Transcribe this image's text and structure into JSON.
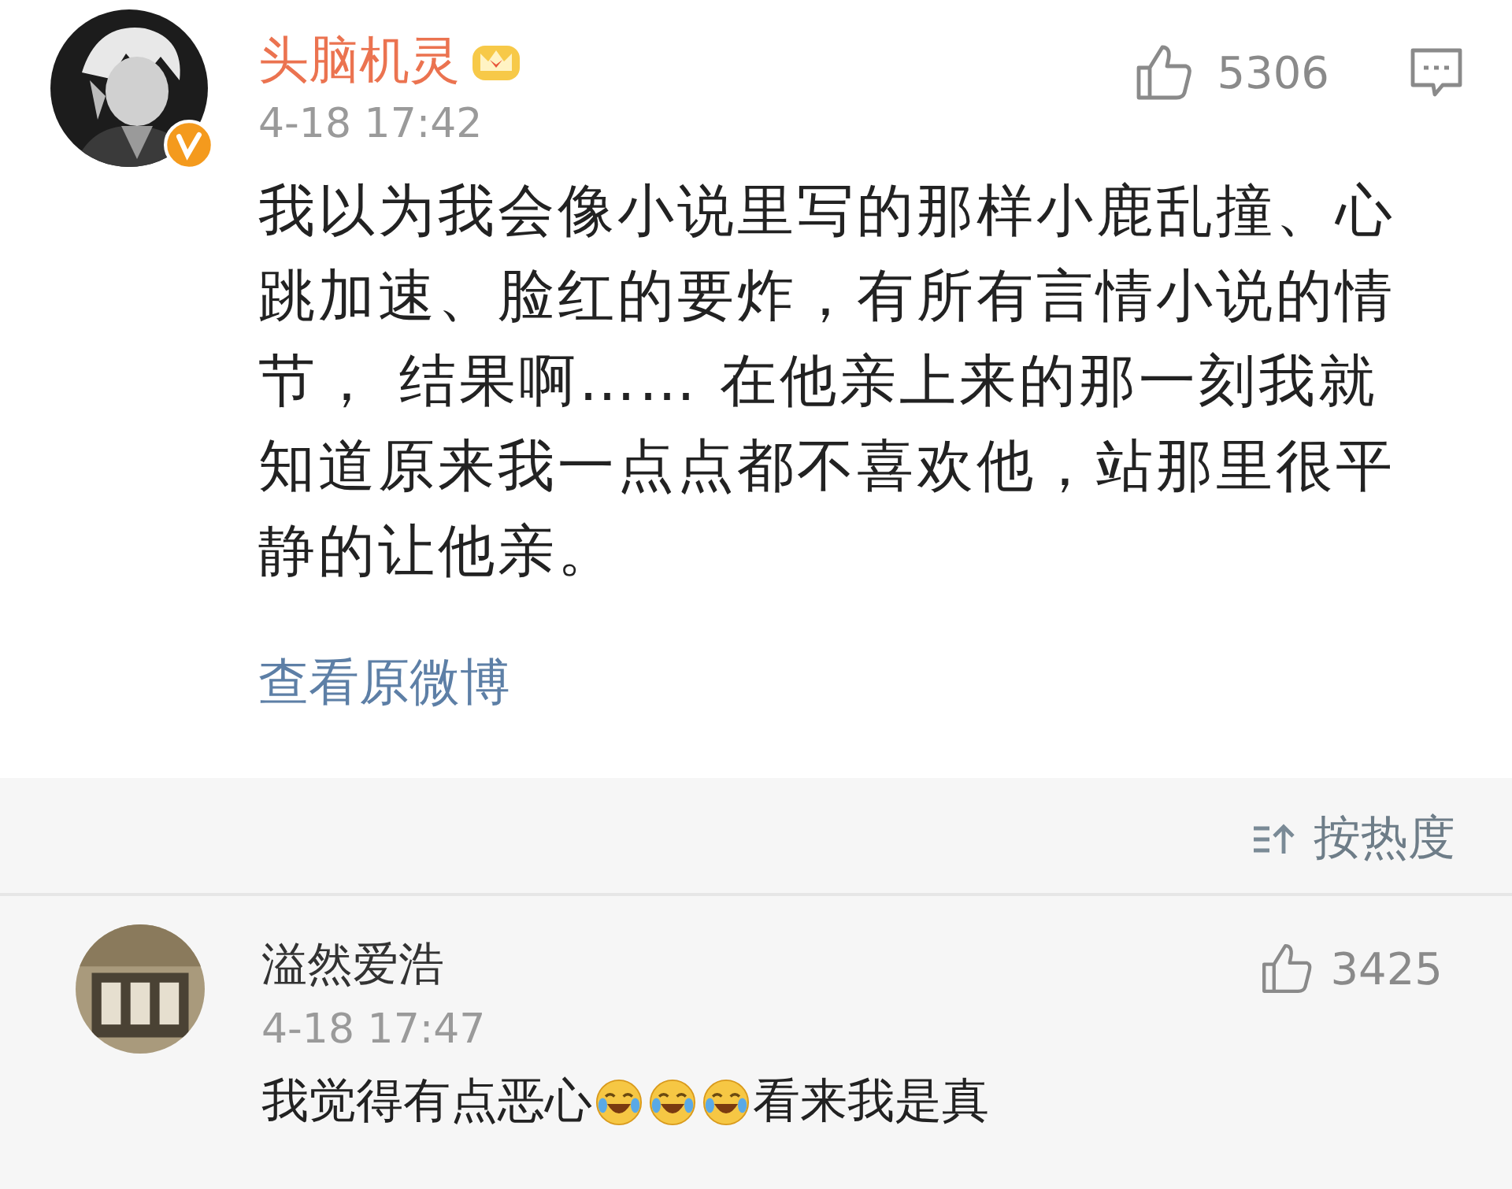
{
  "post": {
    "author": "头脑机灵",
    "verified": true,
    "vip": true,
    "time": "4-18 17:42",
    "likes": "5306",
    "text": "我以为我会像小说里写的那样小鹿乱撞、心跳加速、脸红的要炸，有所有言情小说的情节， 结果啊…… 在他亲上来的那一刻我就知道原来我一点点都不喜欢他，站那里很平静的让他亲。",
    "link": "查看原微博"
  },
  "sort": {
    "label": "按热度"
  },
  "comments": [
    {
      "author": "溢然爱浩",
      "time": "4-18 17:47",
      "likes": "3425",
      "content": [
        {
          "kind": "text",
          "text": "我觉得有点恶心"
        },
        {
          "kind": "emoji"
        },
        {
          "kind": "emoji"
        },
        {
          "kind": "emoji"
        },
        {
          "kind": "text",
          "text": "看来我是真"
        }
      ]
    }
  ]
}
